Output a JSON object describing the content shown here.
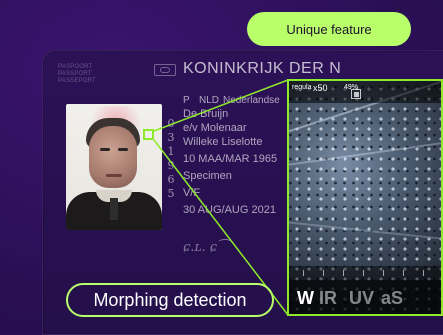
{
  "badges": {
    "unique_feature": "Unique feature",
    "morphing_detection": "Morphing detection"
  },
  "passport": {
    "doc_labels": [
      "PASPOORT",
      "PASSPORT",
      "PASSEPORT"
    ],
    "country_title": "KONINKRIJK DER N",
    "type": "P",
    "code": "NLD",
    "nationality": "Nederlandse",
    "surname": "De Bruijn",
    "spouse": "e/v Molenaar",
    "given_names": "Willeke Liselotte",
    "birth_date": "10 MAA/MAR 1965",
    "birth_place": "Specimen",
    "sex": "V/F",
    "expiry": "30 AUG/AUG 2021",
    "vertical_digits": [
      "0",
      "3",
      "1",
      "9",
      "6",
      "5"
    ],
    "signature": "ɕ.ʟ. ɕ⁀"
  },
  "magnifier": {
    "mode_label": "regula",
    "zoom": "x50",
    "percent": "49%",
    "modes": [
      "W",
      "IR",
      "UV",
      "aS"
    ],
    "active_mode": "W",
    "colors": {
      "highlight": "#8eea2a",
      "badge": "#b8ff6a",
      "bg": "#2a0f55"
    }
  }
}
